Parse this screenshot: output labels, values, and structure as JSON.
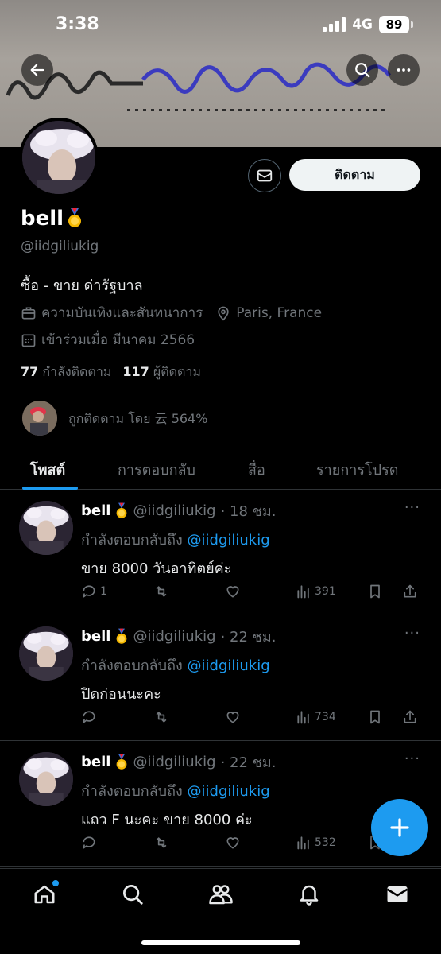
{
  "status_bar": {
    "time": "3:38",
    "network": "4G",
    "battery": "89"
  },
  "profile": {
    "name": "bell",
    "badge_icon": "medal-icon",
    "handle": "@iidgiliukig",
    "bio": "ซื้อ - ขาย ด่ารัฐบาล",
    "category": "ความบันเทิงและสันทนาการ",
    "location": "Paris, France",
    "joined": "เข้าร่วมเมื่อ มีนาคม 2566",
    "following_count": "77",
    "following_label": "กำลังติดตาม",
    "followers_count": "117",
    "followers_label": "ผู้ติดตาม",
    "followed_by": "ถูกติดตาม โดย 云 564%",
    "follow_button": "ติดตาม"
  },
  "tabs": [
    {
      "label": "โพสต์",
      "active": true
    },
    {
      "label": "การตอบกลับ",
      "active": false
    },
    {
      "label": "สื่อ",
      "active": false
    },
    {
      "label": "รายการโปรด",
      "active": false
    }
  ],
  "posts": [
    {
      "name": "bell",
      "handle": "@iidgiliukig",
      "time": "· 18 ชม.",
      "reply_prefix": "กำลังตอบกลับถึง",
      "reply_to": "@iidgiliukig",
      "text": "ขาย 8000 วันอาทิตย์ค่ะ",
      "replies": "1",
      "views": "391"
    },
    {
      "name": "bell",
      "handle": "@iidgiliukig",
      "time": "· 22 ชม.",
      "reply_prefix": "กำลังตอบกลับถึง",
      "reply_to": "@iidgiliukig",
      "text": "ปิดก่อนนะคะ",
      "replies": "",
      "views": "734"
    },
    {
      "name": "bell",
      "handle": "@iidgiliukig",
      "time": "· 22 ชม.",
      "reply_prefix": "กำลังตอบกลับถึง",
      "reply_to": "@iidgiliukig",
      "text": "แถว F นะคะ ขาย 8000 ค่ะ",
      "replies": "",
      "views": "532"
    }
  ],
  "colors": {
    "accent": "#1d9bf0",
    "muted": "#71767b",
    "background": "#000000"
  }
}
